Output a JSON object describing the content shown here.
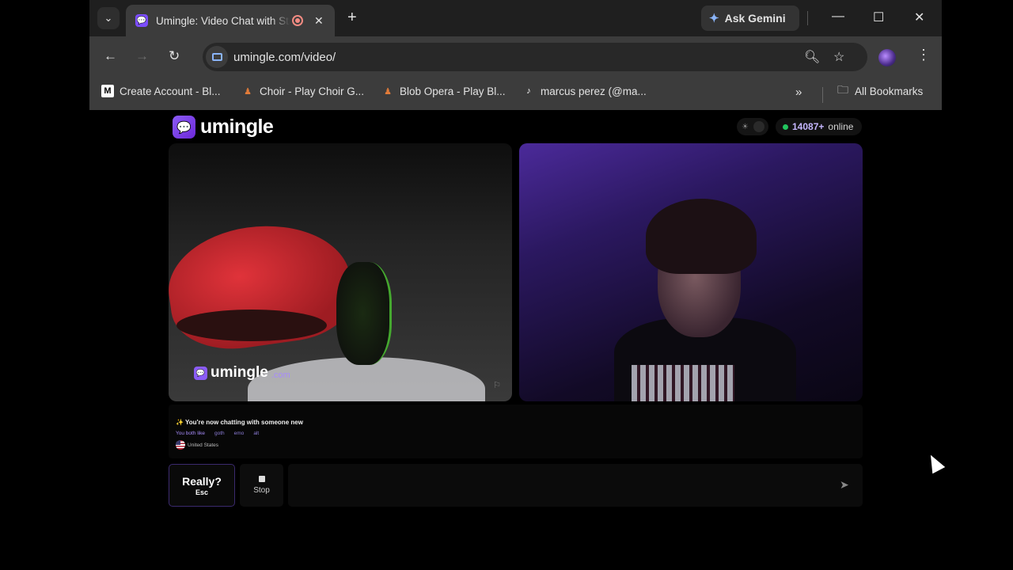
{
  "browser": {
    "tab_title": "Umingle: Video Chat with Strangers",
    "url": "umingle.com/video/",
    "ask_gemini": "Ask Gemini",
    "bookmarks": [
      {
        "label": "Create Account - Bl...",
        "icon": "bluesky-like-icon"
      },
      {
        "label": "Choir - Play Choir G...",
        "icon": "choir-figure-icon"
      },
      {
        "label": "Blob Opera - Play Bl...",
        "icon": "choir-figure-icon"
      },
      {
        "label": "marcus perez (@ma...",
        "icon": "tiktok-icon"
      }
    ],
    "all_bookmarks": "All Bookmarks"
  },
  "page": {
    "logo_text": "umingle",
    "online_count": "14087+",
    "online_label": "online",
    "watermark_text": "umingle",
    "watermark_domain": ".com",
    "info": {
      "status": "You're now chatting with someone new",
      "both_like_label": "You both like",
      "interests": [
        "goth",
        "emo",
        "alt"
      ],
      "country": "United States"
    },
    "really_label": "Really?",
    "really_shortcut": "Esc",
    "stop_label": "Stop",
    "chat_placeholder": ""
  },
  "colors": {
    "brand": "#8b5cf6",
    "online_dot": "#22c55e"
  }
}
